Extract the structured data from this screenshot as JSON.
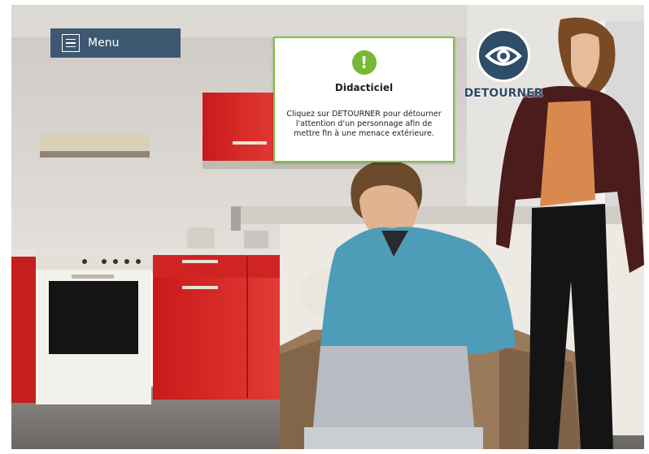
{
  "menu": {
    "label": "Menu"
  },
  "tutorial": {
    "title": "Didacticiel",
    "text": "Cliquez sur DETOURNER pour détourner l'attention d'un personnage afin de mettre fin à une menace extérieure.",
    "accent_color": "#77b934"
  },
  "action": {
    "label": "DETOURNER",
    "icon": "eye-icon",
    "color": "#2f4c68"
  }
}
